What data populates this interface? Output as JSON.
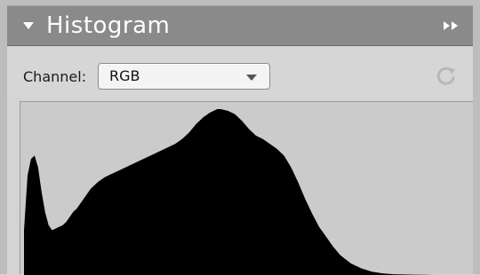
{
  "panel": {
    "title": "Histogram",
    "menu_icon": "double-arrow-right-icon",
    "collapse_icon": "triangle-down-icon"
  },
  "controls": {
    "channel_label": "Channel:",
    "channel_value": "RGB",
    "refresh_icon": "refresh-icon"
  },
  "colors": {
    "titlebar": "#8a8a8a",
    "panel_bg": "#d6d6d6",
    "histogram_fill": "#000000",
    "histogram_bg": "#cbcbcb"
  },
  "chart_data": {
    "type": "area",
    "title": "",
    "xlabel": "",
    "ylabel": "",
    "xlim": [
      0,
      255
    ],
    "ylim": [
      0,
      100
    ],
    "grid": false,
    "x": [
      0,
      2,
      4,
      6,
      8,
      10,
      12,
      14,
      16,
      18,
      20,
      22,
      24,
      26,
      28,
      30,
      34,
      38,
      42,
      46,
      50,
      54,
      58,
      62,
      66,
      70,
      74,
      78,
      82,
      86,
      90,
      94,
      98,
      102,
      106,
      110,
      112,
      116,
      120,
      124,
      128,
      132,
      136,
      140,
      144,
      148,
      152,
      156,
      160,
      164,
      168,
      172,
      176,
      180,
      186,
      192,
      198,
      204,
      210,
      216,
      222,
      228,
      234,
      240,
      246,
      250,
      255
    ],
    "values": [
      27,
      60,
      70,
      72,
      65,
      50,
      38,
      30,
      27,
      28,
      29,
      30,
      32,
      35,
      38,
      40,
      46,
      52,
      56,
      59,
      61,
      63,
      65,
      67,
      69,
      71,
      73,
      75,
      77,
      79,
      82,
      86,
      91,
      95,
      98,
      100,
      100,
      99,
      97,
      93,
      88,
      84,
      82,
      79,
      76,
      72,
      65,
      56,
      46,
      37,
      29,
      23,
      17,
      12,
      7,
      4,
      2,
      1,
      0.5,
      0.3,
      0.2,
      0.1,
      0,
      0,
      0,
      0,
      0
    ]
  }
}
